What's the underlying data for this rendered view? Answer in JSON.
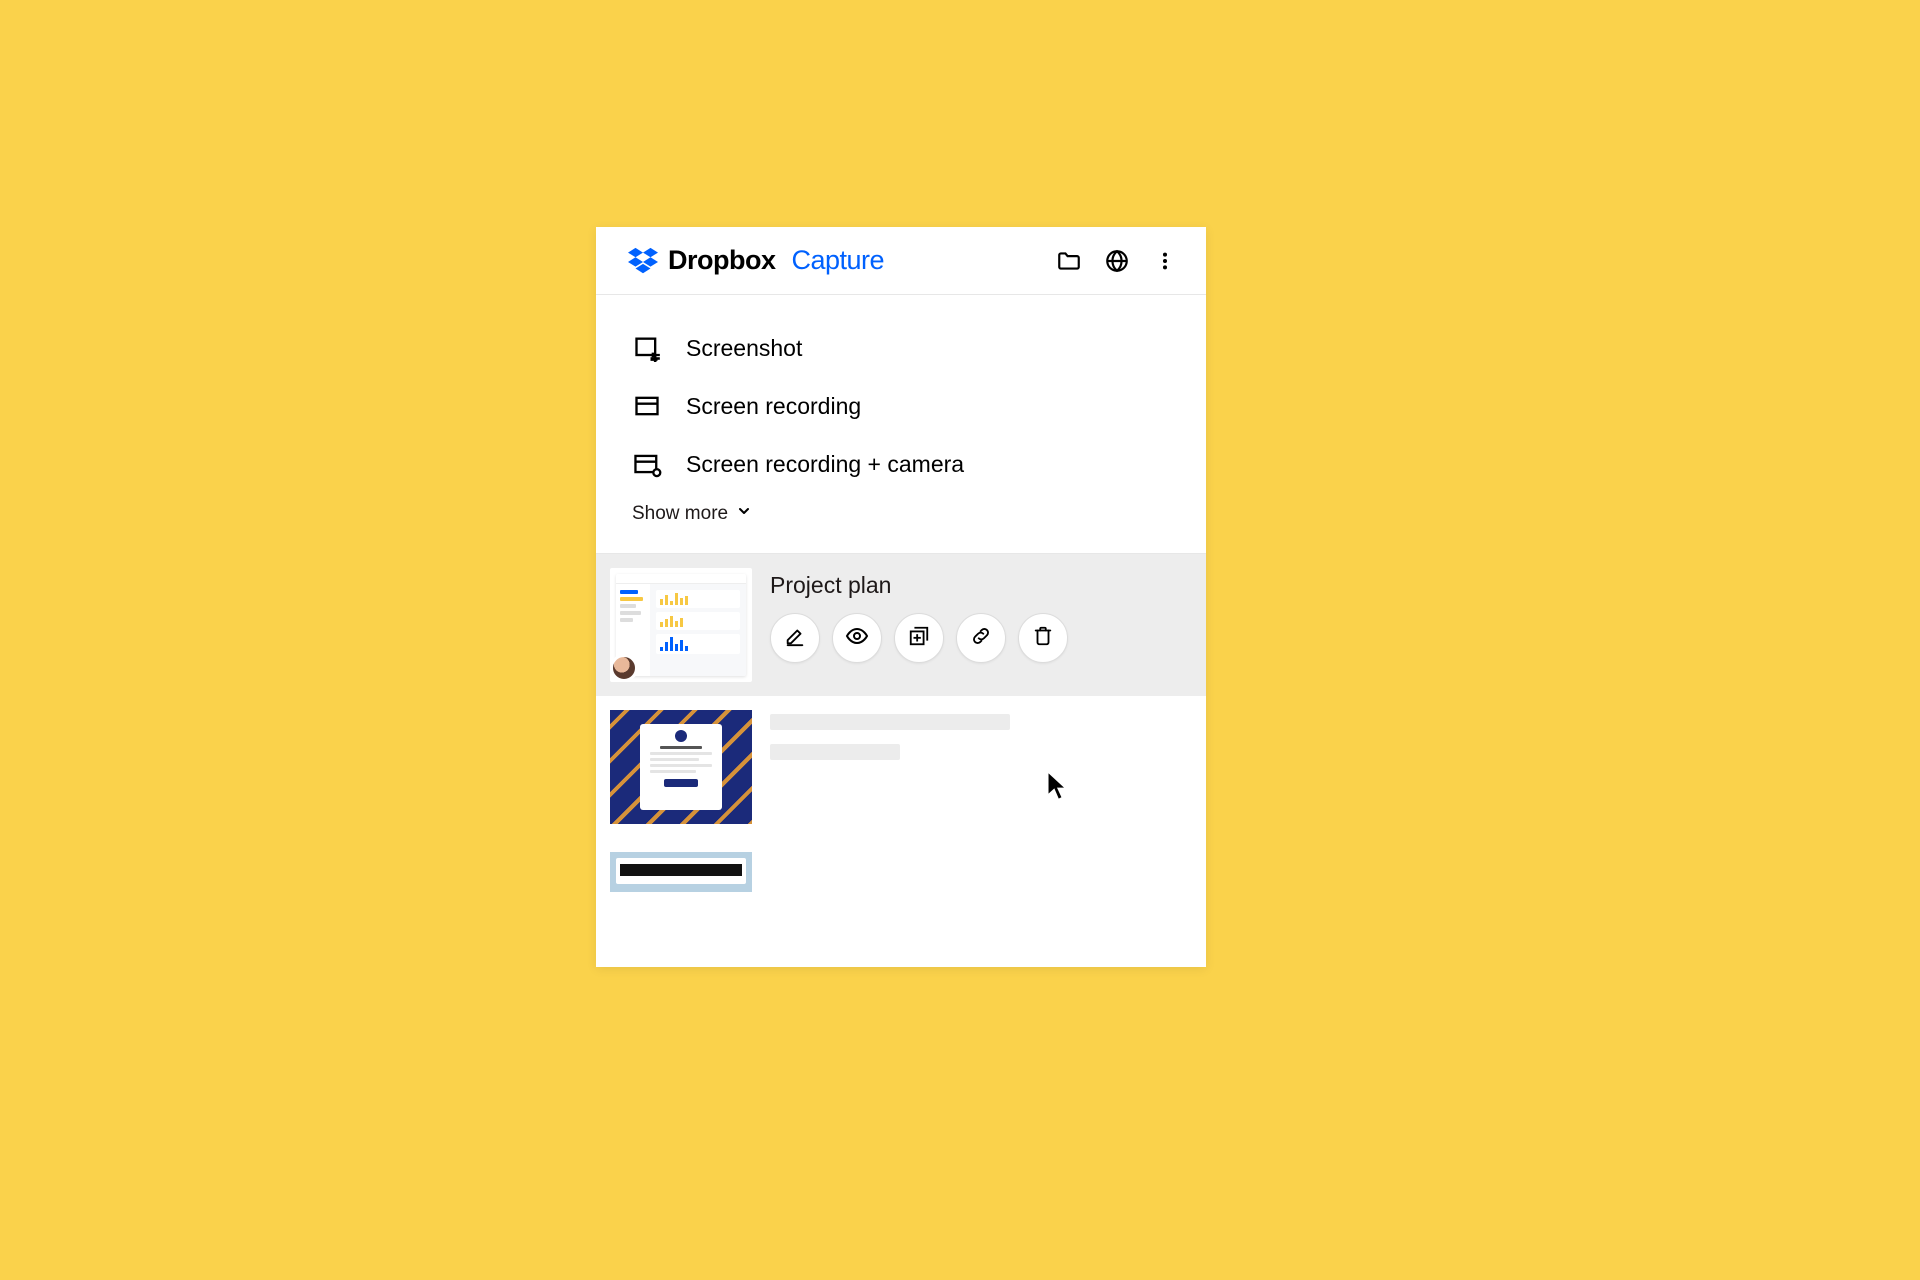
{
  "brand": {
    "primary": "Dropbox",
    "secondary": "Capture"
  },
  "capture_options": [
    {
      "id": "screenshot",
      "label": "Screenshot"
    },
    {
      "id": "recording",
      "label": "Screen recording"
    },
    {
      "id": "rec_cam",
      "label": "Screen recording + camera"
    }
  ],
  "show_more_label": "Show more",
  "items": [
    {
      "title": "Project plan"
    }
  ],
  "colors": {
    "accent": "#0061fe",
    "bg": "#fad24b"
  }
}
